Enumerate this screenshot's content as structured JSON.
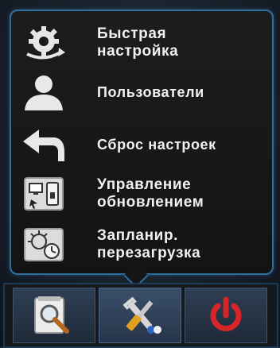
{
  "menu": {
    "items": [
      {
        "label": "Быстрая\nнастройка",
        "icon": "gear-icon"
      },
      {
        "label": "Пользователи",
        "icon": "user-icon"
      },
      {
        "label": "Сброс настроек",
        "icon": "undo-icon"
      },
      {
        "label": "Управление\nобновлением",
        "icon": "update-icon"
      },
      {
        "label": "Запланир.\nперезагрузка",
        "icon": "schedule-reboot-icon"
      }
    ]
  },
  "taskbar": {
    "buttons": [
      {
        "icon": "search-icon"
      },
      {
        "icon": "tools-icon"
      },
      {
        "icon": "power-icon"
      }
    ]
  },
  "colors": {
    "accent": "#2f6f9c",
    "power": "#d6262a"
  }
}
